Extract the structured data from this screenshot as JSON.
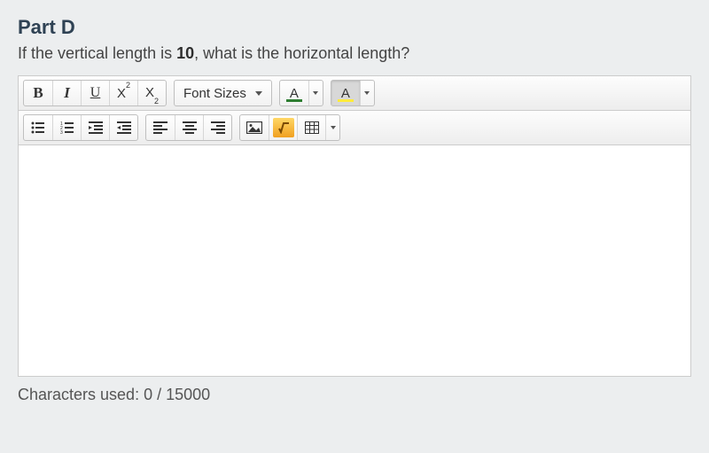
{
  "part": {
    "title": "Part D",
    "question_prefix": "If the vertical length is ",
    "question_value": "10",
    "question_suffix": ", what is the horizontal length?"
  },
  "toolbar": {
    "font_sizes_label": "Font Sizes",
    "forecolor_letter": "A",
    "backcolor_letter": "A",
    "forecolor_swatch": "#2e7d32",
    "backcolor_swatch": "#ffeb3b"
  },
  "char_count": {
    "prefix": "Characters used: ",
    "used": "0",
    "sep": " / ",
    "max": "15000"
  }
}
